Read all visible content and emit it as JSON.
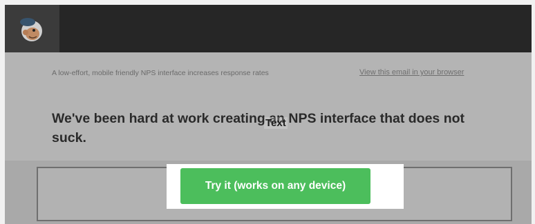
{
  "email": {
    "header": {
      "logo_icon": "monkey-logo-icon"
    },
    "preheader_text": "A low-effort, mobile friendly NPS interface increases response rates",
    "browser_link": "View this email in your browser",
    "headline": "We've been hard at work creating an NPS interface that does not suck.",
    "overlay_label": "Text",
    "cta_label": "Try it (works on any device)"
  },
  "colors": {
    "top_bar": "#262626",
    "content_bg": "#b4b4b4",
    "cta_green": "#4cbe5c",
    "highlight": "#ffffff"
  }
}
